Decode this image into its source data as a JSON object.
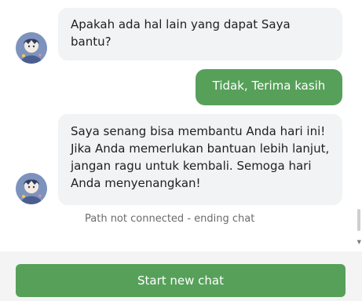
{
  "messages": {
    "bot_1": "Apakah ada hal lain yang dapat Saya bantu?",
    "user_1": "Tidak, Terima kasih",
    "bot_2": "Saya senang bisa membantu Anda hari ini! Jika Anda memerlukan bantuan lebih lanjut, jangan ragu untuk kembali. Semoga hari Anda menyenangkan!"
  },
  "status": {
    "text": "Path not connected - ending chat"
  },
  "footer": {
    "start_label": "Start new chat"
  },
  "icons": {
    "avatar": "bot-avatar-icon",
    "scroll_down": "scroll-down-arrow-icon"
  },
  "colors": {
    "accent_green": "#57a05a",
    "bot_bubble": "#f1f3f4",
    "status_text": "#6b6b6b"
  }
}
